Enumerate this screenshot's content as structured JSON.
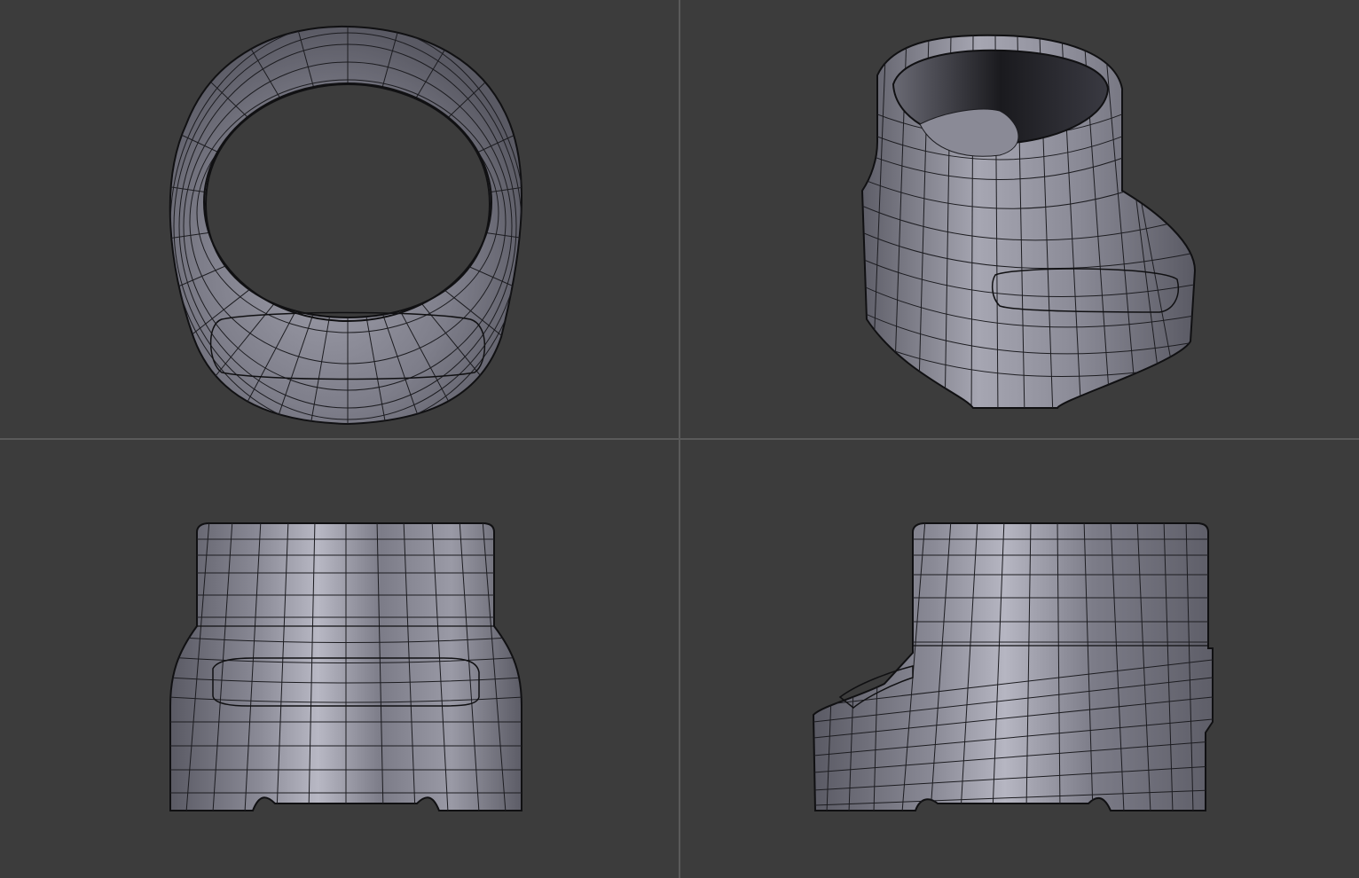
{
  "viewports": [
    {
      "id": "top",
      "view": "top"
    },
    {
      "id": "perspective",
      "view": "perspective"
    },
    {
      "id": "front",
      "view": "front"
    },
    {
      "id": "side",
      "view": "side"
    }
  ],
  "colors": {
    "background": "#3c3c3c",
    "divider": "#5a5a5a",
    "mesh_body": "#8a8a96",
    "mesh_highlight": "#b4b4c0",
    "mesh_shadow": "#55555e",
    "wire": "#1c1c20",
    "outline": "#101012"
  }
}
